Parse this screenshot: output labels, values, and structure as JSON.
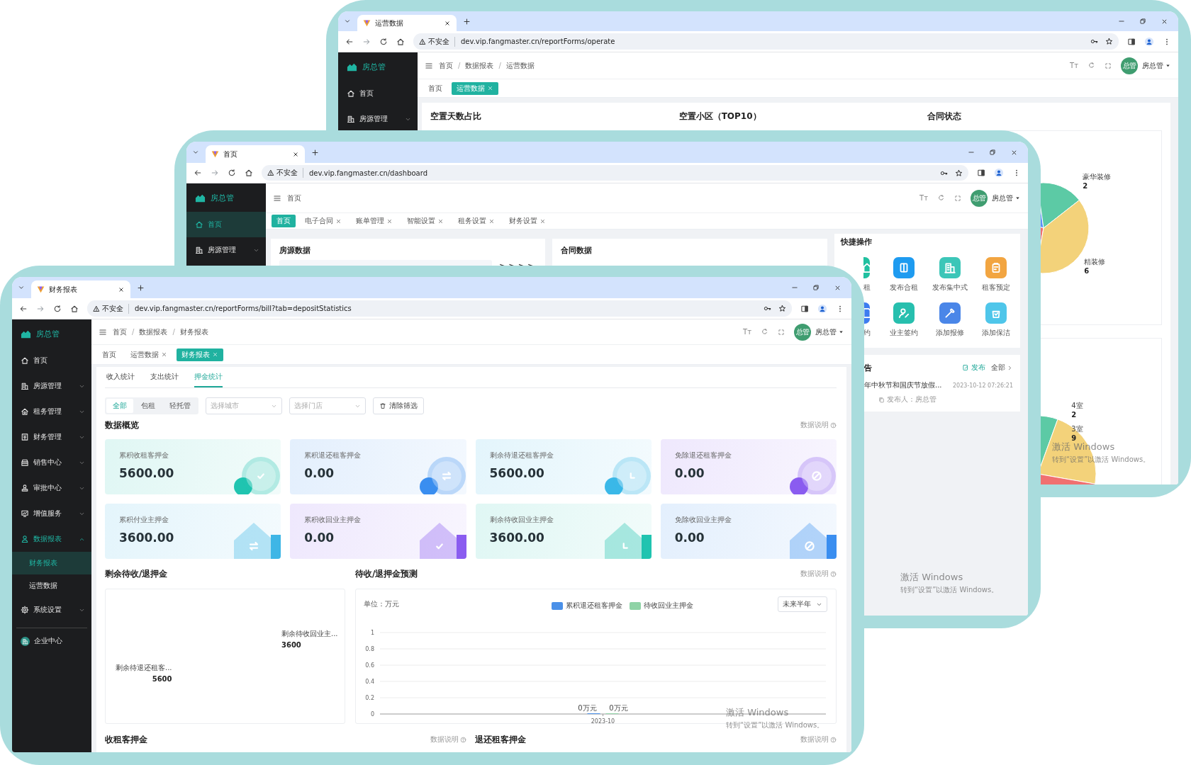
{
  "windows": [
    {
      "kind": "operations",
      "tab_title": "运营数据",
      "security": "不安全",
      "url": "dev.vip.fangmaster.cn/reportForms/operate",
      "brand": "房总管",
      "sidebar": [
        {
          "label": "首页",
          "selected": false
        },
        {
          "label": "房源管理",
          "selected": false,
          "expanded": false
        }
      ],
      "breadcrumbs": [
        "首页",
        "数据报表",
        "运营数据"
      ],
      "breadcrumb_separator": "/",
      "font_button": "Tт",
      "avatar": "总管",
      "user": "房总管",
      "tags": [
        {
          "label": "首页",
          "selected": false,
          "closable": false
        },
        {
          "label": "运营数据",
          "selected": true,
          "closable": true
        }
      ],
      "panels": [
        {
          "title": "空置天数占比"
        },
        {
          "title": "空置小区（TOP10）"
        },
        {
          "title": "合同状态",
          "pies": [
            {
              "labels": [
                {
                  "name": "豪华装修",
                  "value": "2"
                },
                {
                  "name": "精装修",
                  "value": "6"
                }
              ]
            },
            {
              "labels": [
                {
                  "name": "4室",
                  "value": "2"
                },
                {
                  "name": "3室",
                  "value": "9"
                }
              ]
            }
          ]
        }
      ],
      "watermark": {
        "title": "激活 Windows",
        "hint": "转到“设置”以激活 Windows。"
      }
    },
    {
      "kind": "dashboard",
      "tab_title": "首页",
      "security": "不安全",
      "url": "dev.vip.fangmaster.cn/dashboard",
      "brand": "房总管",
      "sidebar": [
        {
          "label": "首页",
          "selected": true
        },
        {
          "label": "房源管理",
          "selected": false,
          "expanded": false
        }
      ],
      "breadcrumbs": [
        "首页"
      ],
      "font_button": "Tт",
      "avatar": "总管",
      "user": "房总管",
      "tags": [
        {
          "label": "首页",
          "selected": true,
          "closable": false
        },
        {
          "label": "电子合同",
          "selected": false,
          "closable": true
        },
        {
          "label": "账单管理",
          "selected": false,
          "closable": true
        },
        {
          "label": "智能设置",
          "selected": false,
          "closable": true
        },
        {
          "label": "租务设置",
          "selected": false,
          "closable": true
        },
        {
          "label": "财务设置",
          "selected": false,
          "closable": true
        }
      ],
      "panels": [
        {
          "title": "房源数据"
        },
        {
          "title": "合同数据"
        }
      ],
      "quick": {
        "title": "快捷操作",
        "items": [
          {
            "label": "租",
            "color": "#20c0a0"
          },
          {
            "label": "发布合租",
            "color": "#1e9bf0"
          },
          {
            "label": "发布集中式",
            "color": "#3cc6b8"
          },
          {
            "label": "租客预定",
            "color": "#f2a541"
          },
          {
            "label": "约",
            "color": "#3d7cf0"
          },
          {
            "label": "业主签约",
            "color": "#27bfae"
          },
          {
            "label": "添加报修",
            "color": "#4a86e8"
          },
          {
            "label": "添加保洁",
            "color": "#4fc6ea"
          }
        ]
      },
      "notice": {
        "title": "告",
        "publish": "发布",
        "view_all": "全部",
        "items": [
          {
            "title": "年中秋节和国庆节放假...",
            "date": "2023-10-12 07:26:21",
            "author": "发布人：房总管"
          }
        ]
      },
      "watermark": {
        "title": "激活 Windows",
        "hint": "转到“设置”以激活 Windows。"
      }
    },
    {
      "kind": "deposit-report",
      "tab_title": "财务报表",
      "security": "不安全",
      "url": "dev.vip.fangmaster.cn/reportForms/bill?tab=depositStatistics",
      "brand": "房总管",
      "sidebar": [
        {
          "label": "首页",
          "selected": false
        },
        {
          "label": "房源管理",
          "selected": false,
          "expanded": false
        },
        {
          "label": "租务管理",
          "selected": false,
          "expanded": false
        },
        {
          "label": "财务管理",
          "selected": false,
          "expanded": false
        },
        {
          "label": "销售中心",
          "selected": false,
          "expanded": false
        },
        {
          "label": "审批中心",
          "selected": false,
          "expanded": false
        },
        {
          "label": "增值服务",
          "selected": false,
          "expanded": false
        },
        {
          "label": "数据报表",
          "selected": false,
          "expanded": true,
          "children": [
            {
              "label": "财务报表",
              "selected": true
            },
            {
              "label": "运营数据",
              "selected": false
            }
          ]
        },
        {
          "label": "系统设置",
          "selected": false,
          "expanded": false
        }
      ],
      "footer_item": {
        "label": "企业中心"
      },
      "breadcrumbs": [
        "首页",
        "数据报表",
        "财务报表"
      ],
      "breadcrumb_separator": "/",
      "font_button": "Tт",
      "avatar": "总管",
      "user": "房总管",
      "tags": [
        {
          "label": "首页",
          "selected": false,
          "closable": false
        },
        {
          "label": "运营数据",
          "selected": false,
          "closable": true
        },
        {
          "label": "财务报表",
          "selected": true,
          "closable": true
        }
      ],
      "sub_tabs": [
        {
          "label": "收入统计",
          "selected": false
        },
        {
          "label": "支出统计",
          "selected": false
        },
        {
          "label": "押金统计",
          "selected": true
        }
      ],
      "segments": [
        {
          "label": "全部",
          "selected": true
        },
        {
          "label": "包租",
          "selected": false
        },
        {
          "label": "轻托管",
          "selected": false
        }
      ],
      "selects": [
        {
          "placeholder": "选择城市"
        },
        {
          "placeholder": "选择门店"
        }
      ],
      "clear_button": "清除筛选",
      "overview": {
        "title": "数据概览",
        "help": "数据说明"
      },
      "cards": [
        {
          "label": "累积收租客押金",
          "value": "5600.00",
          "kind": "circle",
          "color": "#20c4b0"
        },
        {
          "label": "累积退还租客押金",
          "value": "0.00",
          "kind": "circle",
          "color": "#3a8ef0"
        },
        {
          "label": "剩余待退还租客押金",
          "value": "5600.00",
          "kind": "circle",
          "color": "#3ab8e8"
        },
        {
          "label": "免除退还租客押金",
          "value": "0.00",
          "kind": "circle",
          "color": "#8a5cf0"
        },
        {
          "label": "累积付业主押金",
          "value": "3600.00",
          "kind": "house",
          "color": "#3eb6e6"
        },
        {
          "label": "累积收回业主押金",
          "value": "0.00",
          "kind": "house",
          "color": "#8a5cf0"
        },
        {
          "label": "剩余待收回业主押金",
          "value": "3600.00",
          "kind": "house",
          "color": "#20c4b0"
        },
        {
          "label": "免除收回业主押金",
          "value": "0.00",
          "kind": "house",
          "color": "#3a8ef0"
        }
      ],
      "remaining": {
        "title": "剩余待收/退押金",
        "labels": [
          {
            "name": "剩余待退还租客...",
            "value": "5600"
          },
          {
            "name": "剩余待收回业主...",
            "value": "3600"
          }
        ]
      },
      "forecast": {
        "title": "待收/退押金预测",
        "help": "数据说明",
        "unit": "单位：万元",
        "range": "未来半年",
        "chart_data": {
          "type": "bar",
          "categories": [
            "2023-10"
          ],
          "series": [
            {
              "name": "累积退还租客押金",
              "color": "#4a90e8",
              "values": [
                0
              ]
            },
            {
              "name": "待收回业主押金",
              "color": "#8fd3a6",
              "values": [
                0
              ]
            }
          ],
          "grid": true,
          "ylim": [
            0,
            1
          ],
          "yticks": [
            0,
            0.2,
            0.4,
            0.6,
            0.8,
            1
          ],
          "value_labels": [
            "0万元",
            "0万元"
          ]
        }
      },
      "bottom_sections": [
        {
          "title": "收租客押金",
          "help": "数据说明"
        },
        {
          "title": "退还租客押金",
          "help": "数据说明"
        }
      ],
      "watermark": {
        "title": "激活 Windows",
        "hint": "转到“设置”以激活 Windows。"
      }
    }
  ]
}
